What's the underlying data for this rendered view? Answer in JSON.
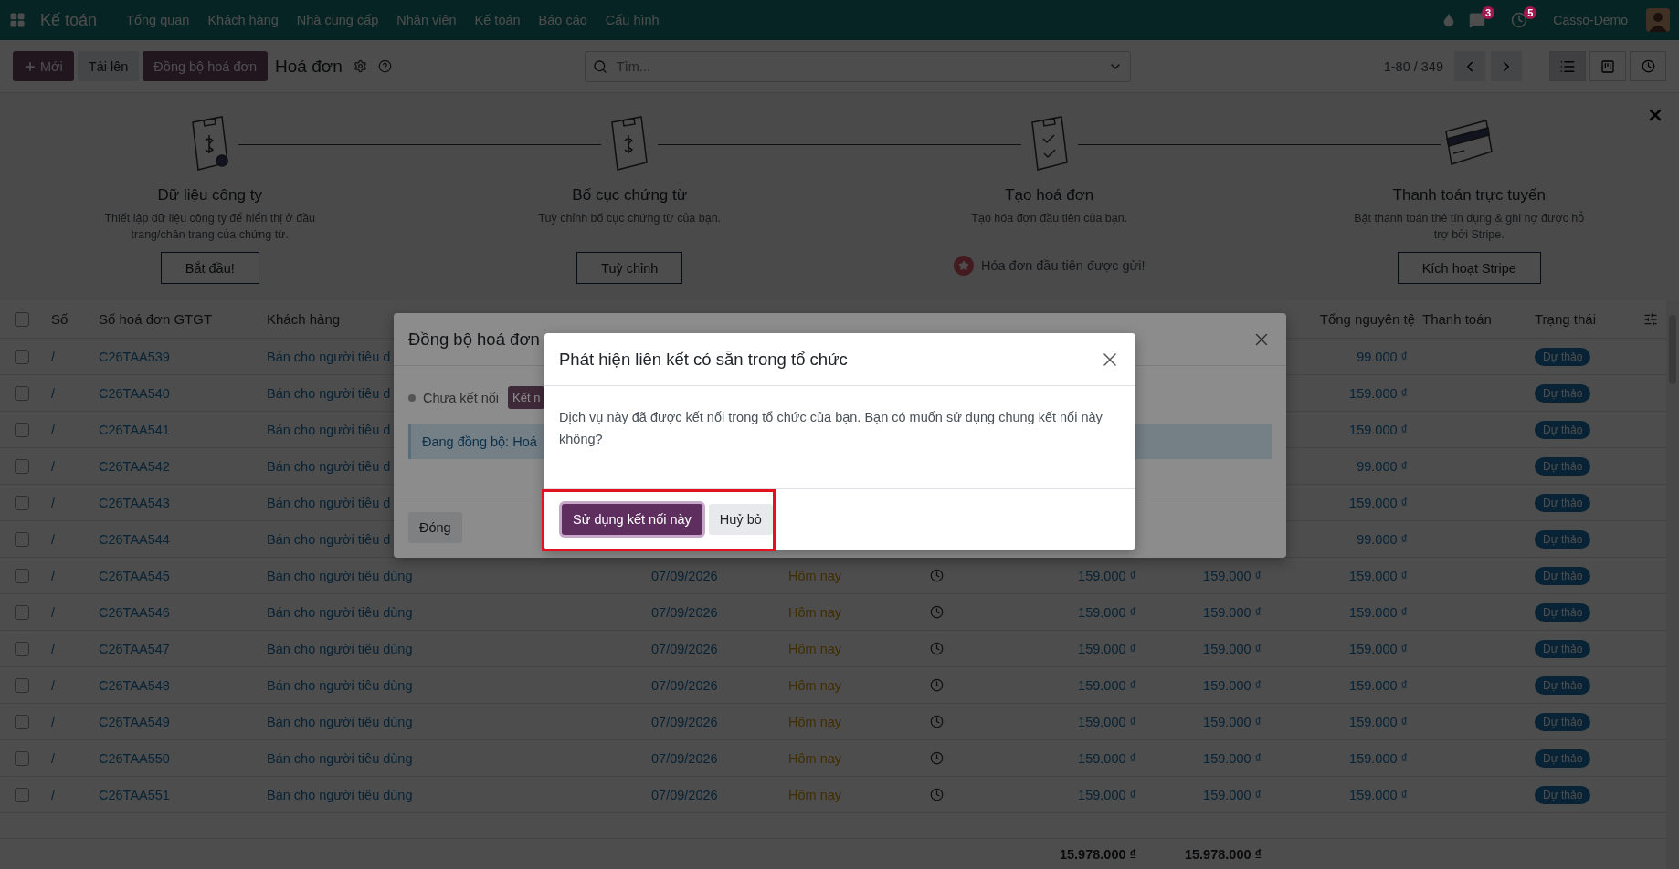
{
  "navbar": {
    "app": "Kế toán",
    "menu": [
      "Tổng quan",
      "Khách hàng",
      "Nhà cung cấp",
      "Nhân viên",
      "Kế toán",
      "Báo cáo",
      "Cấu hình"
    ],
    "messages_count": "3",
    "activities_count": "5",
    "company": "Casso-Demo"
  },
  "control_panel": {
    "buttons": [
      {
        "label": "Mới",
        "kind": "create"
      },
      {
        "label": "Tải lên",
        "kind": "secondary"
      },
      {
        "label": "Đồng bộ hoá đơn",
        "kind": "primary"
      }
    ],
    "title": "Hoá đơn",
    "search": {
      "placeholder": "Tìm..."
    },
    "pager": "1-80 / 349",
    "views": [
      {
        "kind": "list",
        "selected": true
      },
      {
        "kind": "kanban",
        "selected": false
      },
      {
        "kind": "activity",
        "selected": false
      }
    ]
  },
  "onboarding": {
    "steps": [
      {
        "title": "Dữ liệu công ty",
        "description": "Thiết lập dữ liệu công ty để hiển thị ở đầu trang/chân trang của chứng từ.",
        "done": false,
        "action": "Bắt đầu!"
      },
      {
        "title": "Bố cục chứng từ",
        "description": "Tuỳ chỉnh bố cục chứng từ của bạn.",
        "done": false,
        "action": "Tuỳ chỉnh"
      },
      {
        "title": "Tạo hoá đơn",
        "description": "Tạo hóa đơn đầu tiên của bạn.",
        "done": true,
        "action": "Hóa đơn đầu tiên được gửi!"
      },
      {
        "title": "Thanh toán trực tuyến",
        "description": "Bật thanh toán thẻ tín dụng & ghi nợ được hỗ trợ bởi Stripe.",
        "done": false,
        "action": "Kích hoạt Stripe"
      }
    ]
  },
  "table": {
    "select_all": {
      "checked": false
    },
    "columns": [
      "Số",
      "Số hoá đơn GTGT",
      "Khách hàng",
      "Tổng nguyên tệ",
      "Thanh toán",
      "Trạng thái"
    ],
    "rows": [
      {
        "kind": "covered",
        "checked": false,
        "number": "/",
        "invoice": "C26TAA539",
        "customer": "Bán cho người tiêu d",
        "currency_total": "99.000 ₫",
        "status": "Dự thảo"
      },
      {
        "kind": "covered",
        "checked": false,
        "number": "/",
        "invoice": "C26TAA540",
        "customer": "Bán cho người tiêu d",
        "currency_total": "159.000 ₫",
        "status": "Dự thảo"
      },
      {
        "kind": "covered",
        "checked": false,
        "number": "/",
        "invoice": "C26TAA541",
        "customer": "Bán cho người tiêu d",
        "currency_total": "159.000 ₫",
        "status": "Dự thảo"
      },
      {
        "kind": "covered",
        "checked": false,
        "number": "/",
        "invoice": "C26TAA542",
        "customer": "Bán cho người tiêu d",
        "currency_total": "99.000 ₫",
        "status": "Dự thảo"
      },
      {
        "kind": "covered",
        "checked": false,
        "number": "/",
        "invoice": "C26TAA543",
        "customer": "Bán cho người tiêu d",
        "currency_total": "159.000 ₫",
        "status": "Dự thảo"
      },
      {
        "kind": "covered",
        "checked": false,
        "number": "/",
        "invoice": "C26TAA544",
        "customer": "Bán cho người tiêu d",
        "currency_total": "99.000 ₫",
        "status": "Dự thảo"
      },
      {
        "kind": "full",
        "checked": false,
        "number": "/",
        "invoice": "C26TAA545",
        "customer": "Bán cho người tiêu dùng",
        "date": "07/09/2026",
        "due": "Hôm nay",
        "untaxed": "159.000 ₫",
        "total": "159.000 ₫",
        "currency_total": "159.000 ₫",
        "status": "Dự thảo"
      },
      {
        "kind": "full",
        "checked": false,
        "number": "/",
        "invoice": "C26TAA546",
        "customer": "Bán cho người tiêu dùng",
        "date": "07/09/2026",
        "due": "Hôm nay",
        "untaxed": "159.000 ₫",
        "total": "159.000 ₫",
        "currency_total": "159.000 ₫",
        "status": "Dự thảo"
      },
      {
        "kind": "full",
        "checked": false,
        "number": "/",
        "invoice": "C26TAA547",
        "customer": "Bán cho người tiêu dùng",
        "date": "07/09/2026",
        "due": "Hôm nay",
        "untaxed": "159.000 ₫",
        "total": "159.000 ₫",
        "currency_total": "159.000 ₫",
        "status": "Dự thảo"
      },
      {
        "kind": "full",
        "checked": false,
        "number": "/",
        "invoice": "C26TAA548",
        "customer": "Bán cho người tiêu dùng",
        "date": "07/09/2026",
        "due": "Hôm nay",
        "untaxed": "159.000 ₫",
        "total": "159.000 ₫",
        "currency_total": "159.000 ₫",
        "status": "Dự thảo"
      },
      {
        "kind": "full",
        "checked": false,
        "number": "/",
        "invoice": "C26TAA549",
        "customer": "Bán cho người tiêu dùng",
        "date": "07/09/2026",
        "due": "Hôm nay",
        "untaxed": "159.000 ₫",
        "total": "159.000 ₫",
        "currency_total": "159.000 ₫",
        "status": "Dự thảo"
      },
      {
        "kind": "full",
        "checked": false,
        "number": "/",
        "invoice": "C26TAA550",
        "customer": "Bán cho người tiêu dùng",
        "date": "07/09/2026",
        "due": "Hôm nay",
        "untaxed": "159.000 ₫",
        "total": "159.000 ₫",
        "currency_total": "159.000 ₫",
        "status": "Dự thảo"
      },
      {
        "kind": "full",
        "checked": false,
        "number": "/",
        "invoice": "C26TAA551",
        "customer": "Bán cho người tiêu dùng",
        "date": "07/09/2026",
        "due": "Hôm nay",
        "untaxed": "159.000 ₫",
        "total": "159.000 ₫",
        "currency_total": "159.000 ₫",
        "status": "Dự thảo"
      }
    ],
    "totals": [
      "15.978.000 ₫",
      "15.978.000 ₫"
    ]
  },
  "sync_dialog": {
    "title": "Đồng bộ hoá đơn",
    "connection": {
      "label": "Chưa kết nối",
      "connected": false
    },
    "connect_button": "Kết n",
    "info": "Đang đồng bộ: Hoá",
    "close_button": "Đóng"
  },
  "confirm_dialog": {
    "title": "Phát hiện liên kết có sẵn trong tổ chức",
    "message": "Dịch vụ này đã được kết nối trong tổ chức của bạn. Bạn có muốn sử dụng chung kết nối này không?",
    "buttons": [
      {
        "label": "Sử dụng kết nối này",
        "kind": "primary"
      },
      {
        "label": "Huỷ bỏ",
        "kind": "secondary"
      }
    ]
  }
}
